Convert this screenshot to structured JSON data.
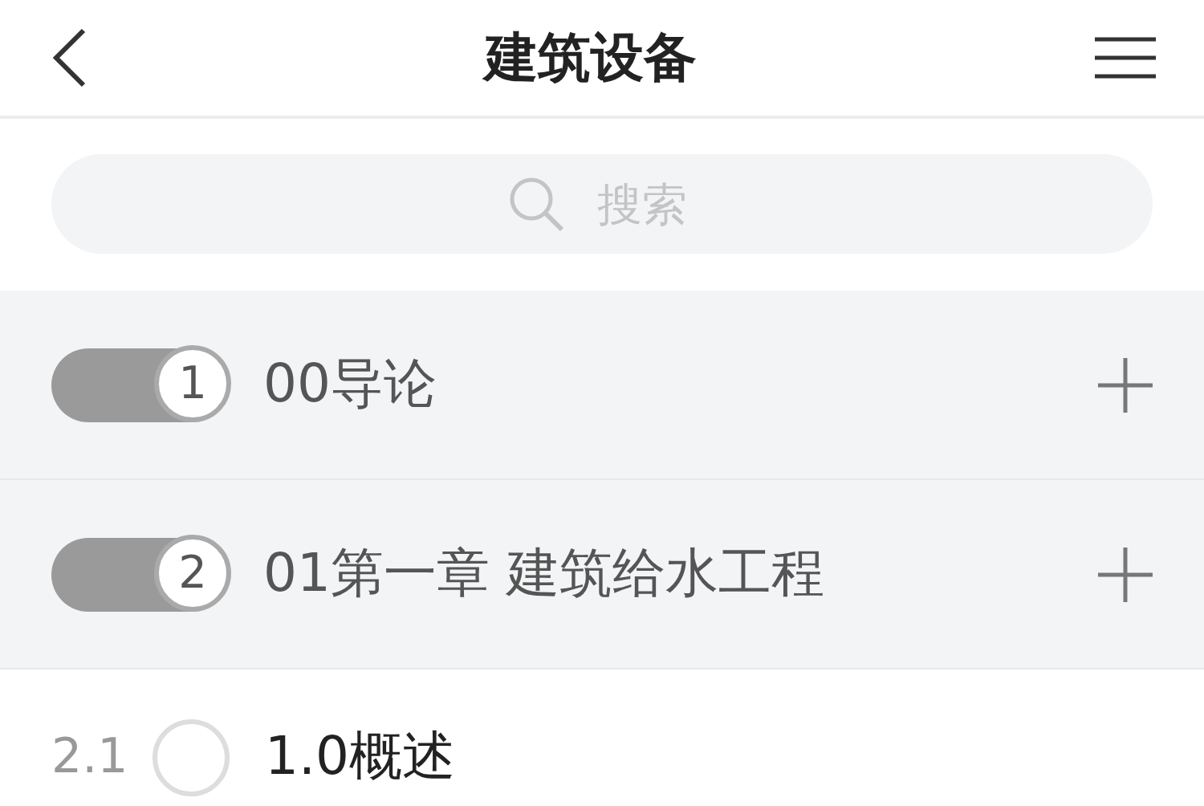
{
  "header": {
    "title": "建筑设备"
  },
  "search": {
    "placeholder": "搜索"
  },
  "items": [
    {
      "kind": "chapter",
      "number": "1",
      "title": "00导论"
    },
    {
      "kind": "chapter",
      "number": "2",
      "title": "01第一章 建筑给水工程"
    },
    {
      "kind": "section",
      "number": "2.1",
      "title": "1.0概述"
    }
  ]
}
